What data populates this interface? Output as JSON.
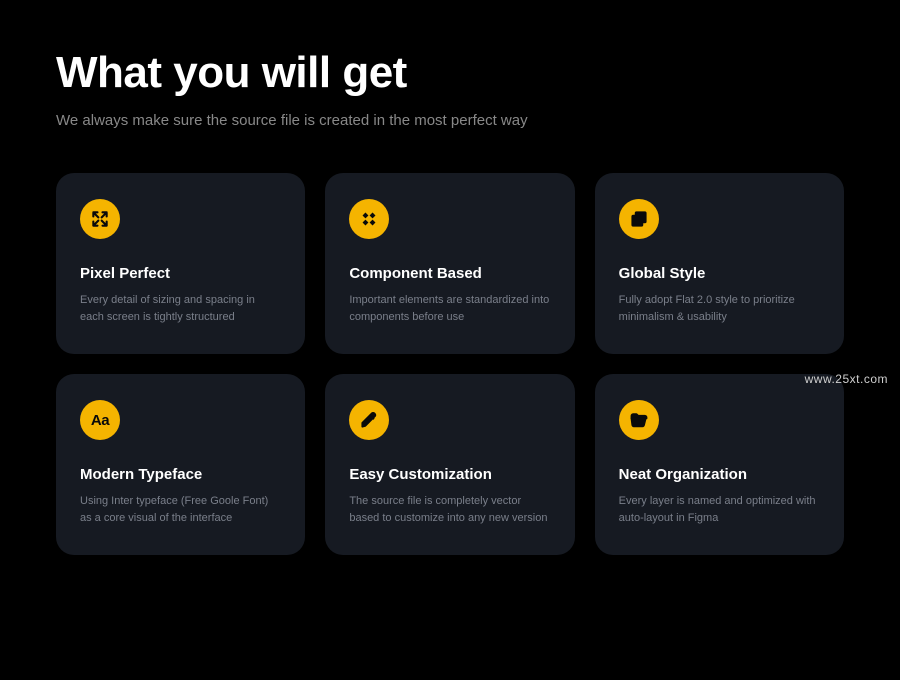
{
  "heading": "What you will get",
  "subtitle": "We always make sure the source file is created in the most perfect way",
  "watermark": "www.25xt.com",
  "cards": [
    {
      "icon": "expand-icon",
      "title": "Pixel Perfect",
      "desc": "Every detail of sizing and spacing in each screen is tightly structured"
    },
    {
      "icon": "component-icon",
      "title": "Component Based",
      "desc": "Important elements are standardized into components before use"
    },
    {
      "icon": "layers-icon",
      "title": "Global Style",
      "desc": "Fully adopt Flat 2.0 style to prioritize minimalism & usability"
    },
    {
      "icon": "typeface-icon",
      "title": "Modern Typeface",
      "desc": "Using Inter typeface (Free Goole Font) as a core visual of the interface"
    },
    {
      "icon": "pencil-icon",
      "title": "Easy Customization",
      "desc": "The source file is completely vector based to customize into any new version"
    },
    {
      "icon": "folder-icon",
      "title": "Neat Organization",
      "desc": "Every layer is named and optimized with auto-layout in Figma"
    }
  ]
}
